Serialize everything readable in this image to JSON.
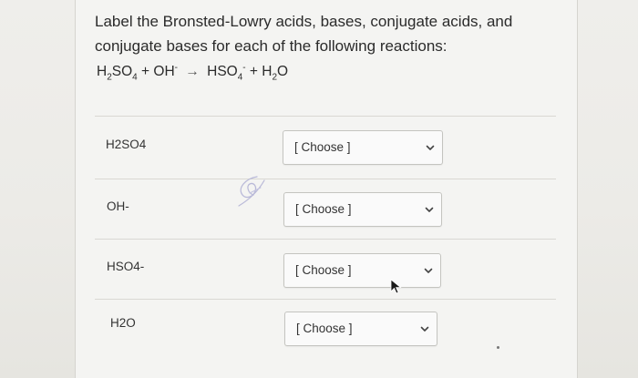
{
  "question": {
    "text": "Label the Bronsted-Lowry acids, bases, conjugate acids, and conjugate bases for each of the following reactions:"
  },
  "equation": {
    "reactant1": "H",
    "reactant1_sub1": "2",
    "reactant1_mid": "SO",
    "reactant1_sub2": "4",
    "plus1": " + OH",
    "reactant2_sup": "-",
    "arrow": "→",
    "product1": "HSO",
    "product1_sub": "4",
    "product1_sup": "-",
    "plus2": " + H",
    "product2_sub": "2",
    "product2_tail": "O"
  },
  "rows": [
    {
      "label": "H2SO4",
      "select_value": "[ Choose ]"
    },
    {
      "label": "OH-",
      "select_value": "[ Choose ]"
    },
    {
      "label": "HSO4-",
      "select_value": "[ Choose ]"
    },
    {
      "label": "H2O",
      "select_value": "[ Choose ]"
    }
  ],
  "icons": {
    "dropdown": "chevron-down-icon",
    "cursor": "mouse-pointer-icon",
    "scribble": "pen-scribble-mark"
  }
}
